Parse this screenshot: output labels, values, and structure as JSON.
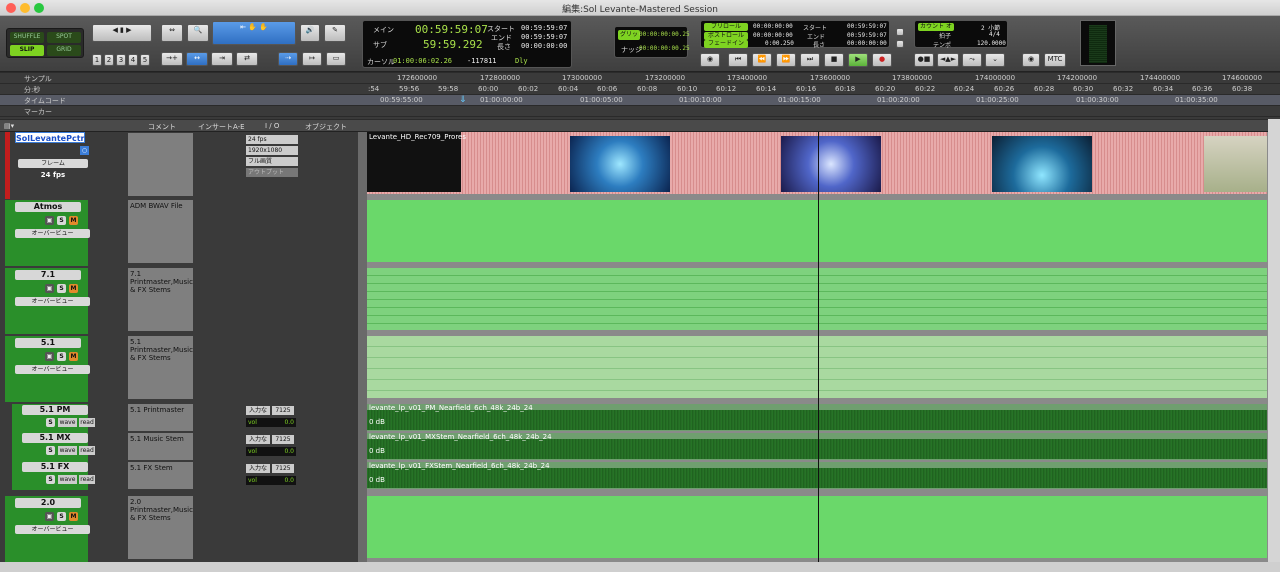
{
  "window": {
    "title": "編集:Sol Levante-Mastered Session"
  },
  "toolbar": {
    "edit_modes": [
      "SHUFFLE",
      "SPOT",
      "SLIP",
      "GRID"
    ],
    "zoom_presets": [
      "1",
      "2",
      "3",
      "4",
      "5"
    ],
    "counter": {
      "main_label": "メイン",
      "main_value": "00:59:59:07",
      "sub_label": "サブ",
      "sub_value": "59:59.292",
      "start_label": "スタート",
      "end_label": "エンド",
      "length_label": "長さ",
      "start_value": "00:59:59:07",
      "end_value": "00:59:59:07",
      "length_value": "00:00:00:00",
      "cursor_label": "カーソル",
      "cursor_value": "01:00:06:02.26",
      "sample_value": "-117811",
      "dly_label": "Dly"
    },
    "grid": {
      "grid_label": "グリッド",
      "grid_value": "00:00:00:00.25",
      "nudge_label": "ナッジ",
      "nudge_value": "00:00:00:00.25"
    },
    "transport_counter": {
      "preroll_label": "プリロール",
      "preroll_value": "00:00:00:00",
      "postroll_label": "ポストロール",
      "postroll_value": "00:00:00:00",
      "fade_label": "フェードイン",
      "fade_value": "0:00.250",
      "start_label": "スタート",
      "start_value": "00:59:59:07",
      "end_label": "エンド",
      "end_value": "00:59:59:07",
      "length_label": "長さ",
      "length_value": "00:00:00:00"
    },
    "meter_panel": {
      "count_label": "カウント オフ",
      "bars_label": "2 小節",
      "meter_label": "拍子",
      "meter_value": "4/4",
      "tempo_label": "テンポ",
      "tempo_value": "120.0000"
    },
    "mtc_label": "MTC"
  },
  "rulers": {
    "samples_label": "サンプル",
    "minsec_label": "分:秒",
    "timecode_label": "タイムコード",
    "markers_label": "マーカー",
    "samples": [
      "172600000",
      "172800000",
      "173000000",
      "173200000",
      "173400000",
      "173600000",
      "173800000",
      "174000000",
      "174200000",
      "174400000",
      "174600000"
    ],
    "minsec": [
      ":54",
      "59:56",
      "59:58",
      "60:00",
      "60:02",
      "60:04",
      "60:06",
      "60:08",
      "60:10",
      "60:12",
      "60:14",
      "60:16",
      "60:18",
      "60:20",
      "60:22",
      "60:24",
      "60:26",
      "60:28",
      "60:30",
      "60:32",
      "60:34",
      "60:36",
      "60:38"
    ],
    "timecode": [
      "00:59:55:00",
      "01:00:00:00",
      "01:00:05:00",
      "01:00:10:00",
      "01:00:15:00",
      "01:00:20:00",
      "01:00:25:00",
      "01:00:30:00",
      "01:00:35:00"
    ]
  },
  "columns": {
    "comment": "コメント",
    "inserts": "インサートA-E",
    "io": "I / O",
    "object": "オブジェクト"
  },
  "video_track": {
    "name": "SolLevantePctr",
    "frame_label": "フレーム",
    "fps": "24 fps",
    "io": [
      "24 fps",
      "1920x1080",
      "フル画質",
      "アウトプット"
    ],
    "clip_name": "Levante_HD_Rec709_Prores"
  },
  "tracks": [
    {
      "name": "Atmos",
      "comment": "ADM BWAV File",
      "overview": "オーバービュー"
    },
    {
      "name": "7.1",
      "comment": "7.1 Printmaster,Music & FX Stems",
      "overview": "オーバービュー"
    },
    {
      "name": "5.1",
      "comment": "5.1 Printmaster,Music & FX Stems",
      "overview": "オーバービュー"
    },
    {
      "name": "2.0",
      "comment": "2.0 Printmaster,Music & FX Stems",
      "overview": "オーバービュー"
    }
  ],
  "audio_tracks": [
    {
      "name": "5.1 PM",
      "comment": "5.1 Printmaster",
      "input": "入力な",
      "bus": "7125",
      "vol_label": "vol",
      "vol": "0.0",
      "view": "wave",
      "mode": "read",
      "clip": "levante_lp_v01_PM_Nearfield_6ch_48k_24b_24",
      "db": "0 dB"
    },
    {
      "name": "5.1 MX",
      "comment": "5.1 Music Stem",
      "input": "入力な",
      "bus": "7125",
      "vol_label": "vol",
      "vol": "0.0",
      "view": "wave",
      "mode": "read",
      "clip": "levante_lp_v01_MXStem_Nearfield_6ch_48k_24b_24",
      "db": "0 dB"
    },
    {
      "name": "5.1 FX",
      "comment": "5.1 FX Stem",
      "input": "入力な",
      "bus": "7125",
      "vol_label": "vol",
      "vol": "0.0",
      "view": "wave",
      "mode": "read",
      "clip": "levante_lp_v01_FXStem_Nearfield_6ch_48k_24b_24",
      "db": "0 dB"
    }
  ],
  "colors": {
    "track_green": "#2a8f2a",
    "clip_green": "#6fd06f",
    "clip_light": "#a8d8a0",
    "video_red": "#e3a7a7",
    "accent_blue": "#3b7dd8"
  }
}
